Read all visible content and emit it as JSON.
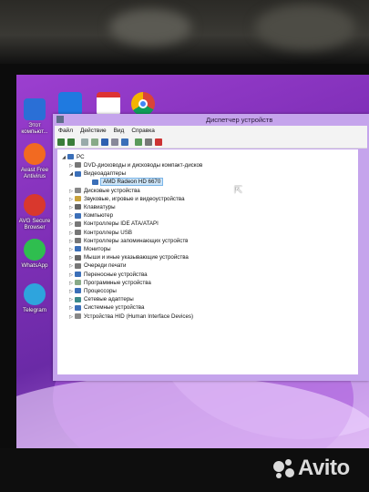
{
  "desktop": {
    "icons": [
      {
        "label": "Этот компьют...",
        "icon": "computer-icon",
        "color": "#2a6fd6"
      },
      {
        "label": "Avast Free Antivirus",
        "icon": "avast-icon",
        "color": "#f26a21"
      },
      {
        "label": "AVG Secure Browser",
        "icon": "avg-browser-icon",
        "color": "#d9382d"
      },
      {
        "label": "WhatsApp",
        "icon": "whatsapp-icon",
        "color": "#2fbe4f"
      },
      {
        "label": "Telegram",
        "icon": "telegram-icon",
        "color": "#2ea4dd"
      }
    ],
    "top_icons": [
      "blue-app-icon",
      "pdf-icon",
      "chrome-icon"
    ]
  },
  "window": {
    "title": "Диспетчер устройств",
    "menu": [
      "Файл",
      "Действие",
      "Вид",
      "Справка"
    ],
    "toolbar": [
      "back-icon",
      "forward-icon",
      "properties-icon",
      "refresh-icon",
      "help-icon",
      "view-icon",
      "monitor-icon",
      "update-driver-icon",
      "disable-icon",
      "uninstall-icon"
    ],
    "tree": {
      "root": "PC",
      "items": [
        {
          "label": "DVD-дисководы и дисководы компакт-дисков",
          "level": 1,
          "expanded": false
        },
        {
          "label": "Видеоадаптеры",
          "level": 1,
          "expanded": true
        },
        {
          "label": "AMD Radeon HD 6670",
          "level": 2,
          "selected": true
        },
        {
          "label": "Дисковые устройства",
          "level": 1,
          "expanded": false
        },
        {
          "label": "Звуковые, игровые и видеоустройства",
          "level": 1,
          "expanded": false
        },
        {
          "label": "Клавиатуры",
          "level": 1,
          "expanded": false
        },
        {
          "label": "Компьютер",
          "level": 1,
          "expanded": false
        },
        {
          "label": "Контроллеры IDE ATA/ATAPI",
          "level": 1,
          "expanded": false
        },
        {
          "label": "Контроллеры USB",
          "level": 1,
          "expanded": false
        },
        {
          "label": "Контроллеры запоминающих устройств",
          "level": 1,
          "expanded": false
        },
        {
          "label": "Мониторы",
          "level": 1,
          "expanded": false
        },
        {
          "label": "Мыши и иные указывающие устройства",
          "level": 1,
          "expanded": false
        },
        {
          "label": "Очереди печати",
          "level": 1,
          "expanded": false
        },
        {
          "label": "Переносные устройства",
          "level": 1,
          "expanded": false
        },
        {
          "label": "Программные устройства",
          "level": 1,
          "expanded": false
        },
        {
          "label": "Процессоры",
          "level": 1,
          "expanded": false
        },
        {
          "label": "Сетевые адаптеры",
          "level": 1,
          "expanded": false
        },
        {
          "label": "Системные устройства",
          "level": 1,
          "expanded": false
        },
        {
          "label": "Устройства HID (Human Interface Devices)",
          "level": 1,
          "expanded": false
        }
      ]
    }
  },
  "watermark": "Avito"
}
